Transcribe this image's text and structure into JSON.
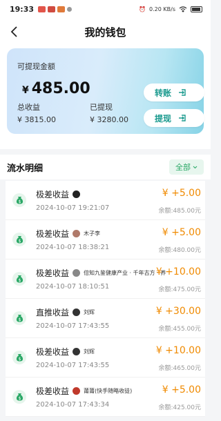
{
  "status_bar": {
    "time": "19:33",
    "network": "0.20 KB/s"
  },
  "header": {
    "title": "我的钱包"
  },
  "card": {
    "label": "可提现金额",
    "currency": "¥",
    "amount": "485.00",
    "total_label": "总收益",
    "total_value": "¥ 3815.00",
    "withdrawn_label": "已提现",
    "withdrawn_value": "¥ 3280.00",
    "transfer_label": "转账",
    "withdraw_label": "提现"
  },
  "section": {
    "title": "流水明细",
    "filter": "全部"
  },
  "transactions": [
    {
      "title": "极差收益",
      "from": "",
      "time": "2024-10-07 19:21:07",
      "amount": "¥ +5.00",
      "balance": "余额:485.00元",
      "avatar_color": "#222222"
    },
    {
      "title": "极差收益",
      "from": "木子李",
      "time": "2024-10-07 18:38:21",
      "amount": "¥ +5.00",
      "balance": "余额:480.00元",
      "avatar_color": "#b07a6a"
    },
    {
      "title": "极差收益",
      "from": "倍知九鉴健康产业 · 千年古方 · 养",
      "time": "2024-10-07 18:10:51",
      "amount": "¥ +10.00",
      "balance": "余额:475.00元",
      "avatar_color": "#888888"
    },
    {
      "title": "直推收益",
      "from": "刘辉",
      "time": "2024-10-07 17:43:55",
      "amount": "¥ +30.00",
      "balance": "余额:455.00元",
      "avatar_color": "#333333"
    },
    {
      "title": "极差收益",
      "from": "刘辉",
      "time": "2024-10-07 17:43:55",
      "amount": "¥ +10.00",
      "balance": "余额:465.00元",
      "avatar_color": "#333333"
    },
    {
      "title": "极差收益",
      "from": "莆莆(快手随略收徒)",
      "time": "2024-10-07 17:43:34",
      "amount": "¥ +5.00",
      "balance": "余额:425.00元",
      "avatar_color": "#c0392b"
    }
  ],
  "colors": {
    "accent": "#1a9a8e",
    "amount": "#f08a00",
    "filter": "#2aa866"
  }
}
